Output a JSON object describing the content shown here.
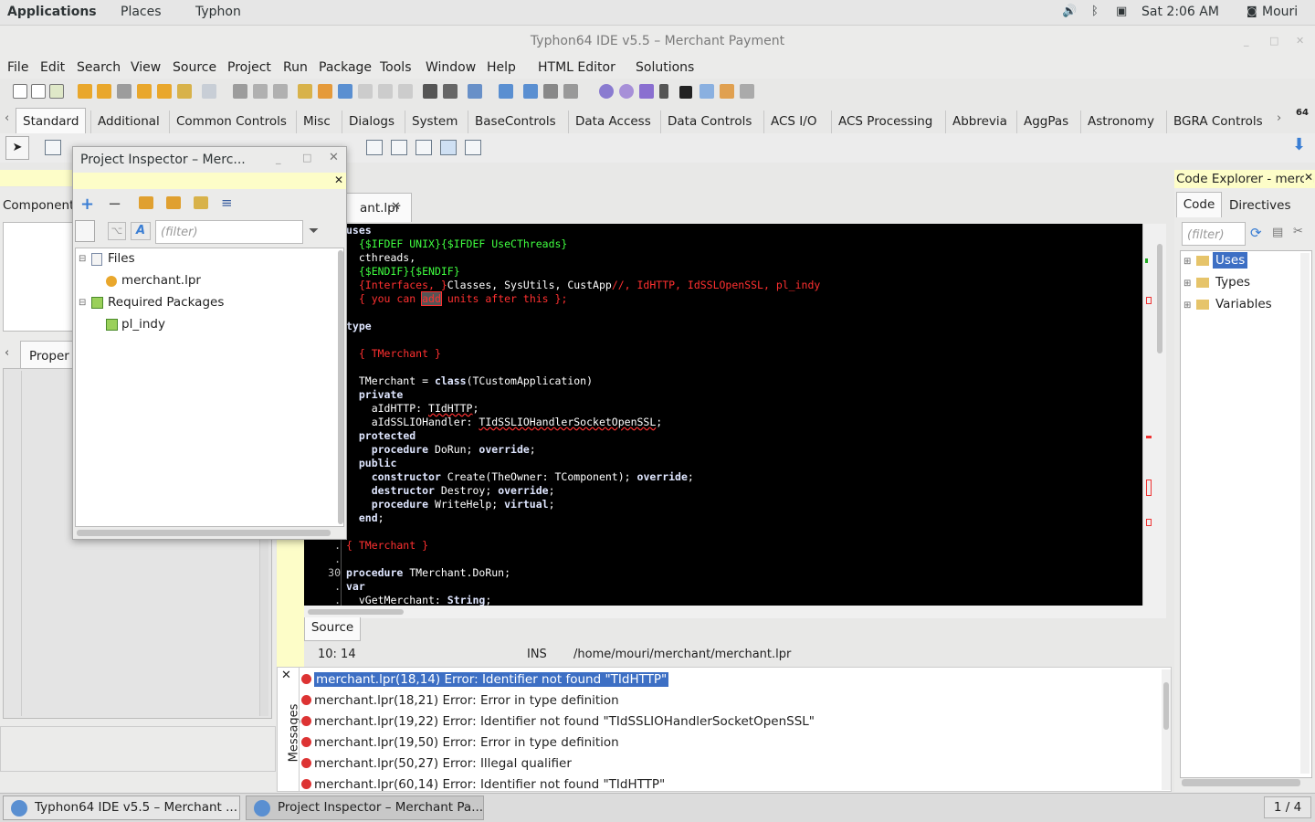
{
  "topbar": {
    "applications": "Applications",
    "places": "Places",
    "typhon": "Typhon",
    "time": "Sat  2:06 AM",
    "user": "Mouri"
  },
  "window": {
    "title": "Typhon64 IDE v5.5 – Merchant Payment"
  },
  "menu": {
    "items": [
      "File",
      "Edit",
      "Search",
      "View",
      "Source",
      "Project",
      "Run",
      "Package",
      "Tools",
      "Window",
      "Help",
      "HTML Editor",
      "Solutions"
    ]
  },
  "palette": {
    "tabs": [
      "Standard",
      "Additional",
      "Common Controls",
      "Misc",
      "Dialogs",
      "System",
      "BaseControls",
      "Data Access",
      "Data Controls",
      "ACS I/O",
      "ACS Processing",
      "Abbrevia",
      "AggPas",
      "Astronomy",
      "BGRA Controls"
    ],
    "active": "Standard",
    "badge": "64"
  },
  "left": {
    "components_label": "Component",
    "properties_tab": "Proper"
  },
  "project_inspector": {
    "title": "Project Inspector – Merc...",
    "filter_placeholder": "(filter)",
    "files_label": "Files",
    "file": "merchant.lpr",
    "required_label": "Required Packages",
    "package": "pl_indy"
  },
  "editor": {
    "tab_label": "ant.lpr",
    "bottom_tab": "Source",
    "cursor": "10: 14",
    "mode": "INS",
    "path": "/home/mouri/merchant/merchant.lpr",
    "line_number_label": "30"
  },
  "messages": {
    "panel_label": "Messages",
    "items": [
      "merchant.lpr(18,14) Error: Identifier not found \"TIdHTTP\"",
      "merchant.lpr(18,21) Error: Error in type definition",
      "merchant.lpr(19,22) Error: Identifier not found \"TIdSSLIOHandlerSocketOpenSSL\"",
      "merchant.lpr(19,50) Error: Error in type definition",
      "merchant.lpr(50,27) Error: Illegal qualifier",
      "merchant.lpr(60,14) Error: Identifier not found \"TIdHTTP\""
    ]
  },
  "code_explorer": {
    "title": "Code Explorer - merch",
    "tab_code": "Code",
    "tab_directives": "Directives",
    "filter_placeholder": "(filter)",
    "nodes": [
      "Uses",
      "Types",
      "Variables"
    ]
  },
  "taskbar": {
    "task1": "Typhon64 IDE v5.5 – Merchant ...",
    "task2": "Project Inspector – Merchant Pa...",
    "pager": "1 / 4"
  },
  "colors": {
    "selection": "#3d6fc4",
    "editor_bg": "#000000",
    "comment": "#ff3030",
    "directive": "#40ff40"
  }
}
